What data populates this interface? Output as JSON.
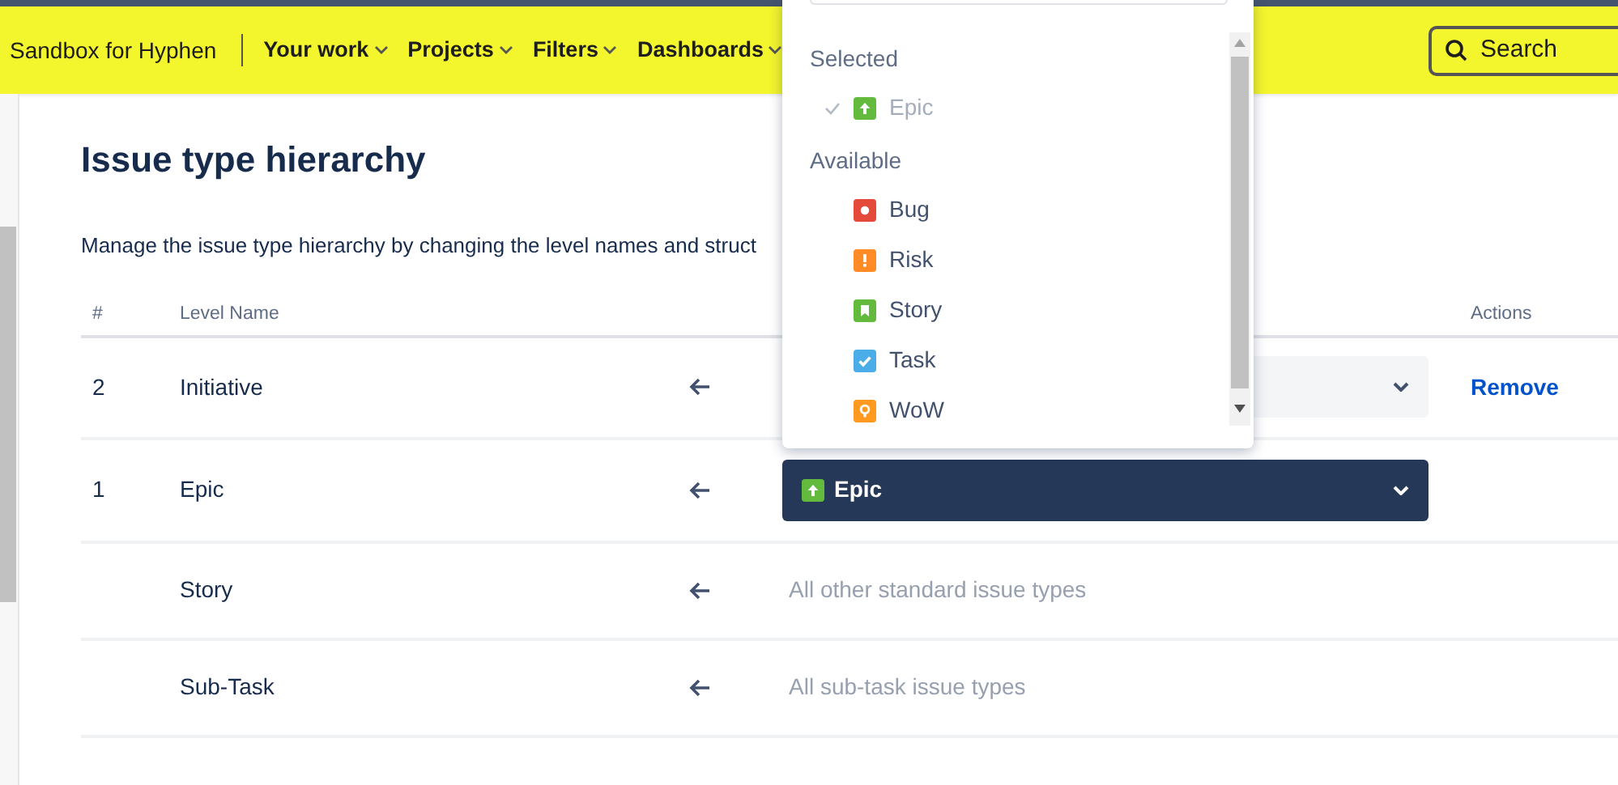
{
  "header": {
    "site": "Sandbox for Hyphen",
    "nav": [
      {
        "label": "Your work"
      },
      {
        "label": "Projects"
      },
      {
        "label": "Filters"
      },
      {
        "label": "Dashboards"
      }
    ],
    "search": "Search"
  },
  "page": {
    "title": "Issue type hierarchy",
    "description": "Manage the issue type hierarchy by changing the level names and struct"
  },
  "table": {
    "columns": [
      "#",
      "Level Name",
      "Actions"
    ],
    "rows": [
      {
        "number": "2",
        "name": "Initiative",
        "mapping": {
          "kind": "select",
          "open": false
        },
        "action": "Remove"
      },
      {
        "number": "1",
        "name": "Epic",
        "mapping": {
          "kind": "select",
          "open": true,
          "value": {
            "label": "Epic",
            "kind": "epic"
          }
        }
      },
      {
        "name": "Story",
        "mapping": {
          "kind": "text",
          "text": "All other standard issue types"
        }
      },
      {
        "name": "Sub-Task",
        "mapping": {
          "kind": "text",
          "text": "All sub-task issue types"
        }
      }
    ]
  },
  "dropdown": {
    "groups": [
      {
        "label": "Selected",
        "items": [
          {
            "label": "Epic",
            "kind": "epic",
            "selected": true
          }
        ]
      },
      {
        "label": "Available",
        "items": [
          {
            "label": "Bug",
            "kind": "bug",
            "selected": false
          },
          {
            "label": "Risk",
            "kind": "risk",
            "selected": false
          },
          {
            "label": "Story",
            "kind": "story",
            "selected": false
          },
          {
            "label": "Task",
            "kind": "task",
            "selected": false
          },
          {
            "label": "WoW",
            "kind": "wow",
            "selected": false
          }
        ]
      }
    ]
  }
}
